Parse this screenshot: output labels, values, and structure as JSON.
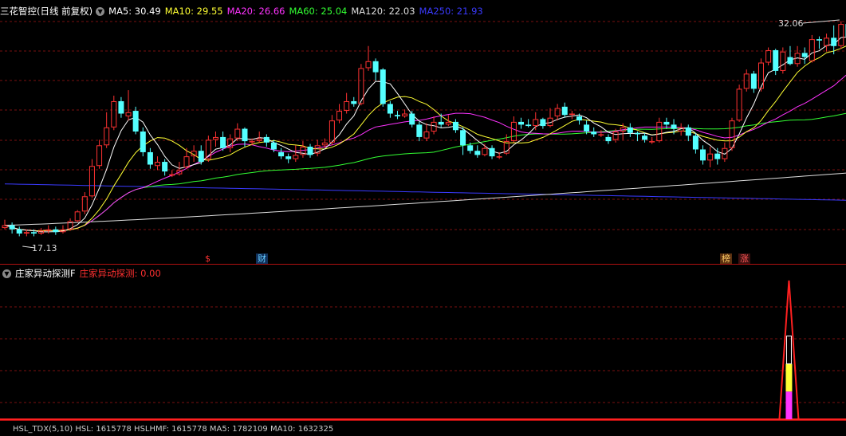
{
  "main_header": {
    "title": "三花智控(日线 前复权)",
    "ma": [
      {
        "label": "MA5: 30.49",
        "color": "#ffffff"
      },
      {
        "label": "MA10: 29.55",
        "color": "#ffff33"
      },
      {
        "label": "MA20: 26.66",
        "color": "#ff33ff"
      },
      {
        "label": "MA60: 25.04",
        "color": "#33ff33"
      },
      {
        "label": "MA120: 22.03",
        "color": "#dddddd"
      },
      {
        "label": "MA250: 21.93",
        "color": "#3a3aff"
      }
    ]
  },
  "price_labels": {
    "high": "32.06",
    "low": "17.13"
  },
  "markers": [
    {
      "text": "$",
      "color": "#ff3333"
    },
    {
      "text": "财",
      "color": "#66ccff"
    },
    {
      "text": "榜",
      "color": "#ffcc66"
    },
    {
      "text": "涨",
      "color": "#ff5555"
    }
  ],
  "indicator_header": {
    "title": "庄家异动探测F",
    "value": "庄家异动探测: 0.00",
    "value_color": "#ff3030"
  },
  "bottom_header": {
    "text": "HSL_TDX(5,10) HSL: 1615778 HSLHMF: 1615778 MA5: 1782109 MA10: 1632325"
  },
  "colors": {
    "up": "#ff3232",
    "down": "#54ffff",
    "grid": "#7a1010",
    "divider": "#b01010",
    "ma5": "#ffffff",
    "ma10": "#ffff33",
    "ma20": "#ff33ff",
    "ma60": "#33ff33",
    "ma120": "#dddddd",
    "ma250": "#3a3aff"
  },
  "chart_data": {
    "type": "candlestick",
    "ylim": [
      16.5,
      33.5
    ],
    "candles": [
      [
        18.0,
        18.2,
        18.6,
        17.9
      ],
      [
        18.2,
        17.9,
        18.4,
        17.6
      ],
      [
        17.9,
        17.6,
        18.1,
        17.4
      ],
      [
        17.6,
        17.7,
        17.9,
        17.4
      ],
      [
        17.7,
        17.6,
        17.9,
        17.4
      ],
      [
        17.6,
        17.8,
        18.0,
        17.5
      ],
      [
        17.8,
        17.9,
        18.2,
        17.6
      ],
      [
        17.9,
        17.7,
        18.1,
        17.5
      ],
      [
        17.7,
        17.9,
        18.2,
        17.6
      ],
      [
        17.9,
        18.5,
        18.7,
        17.8
      ],
      [
        18.5,
        19.2,
        19.3,
        18.4
      ],
      [
        19.2,
        20.3,
        20.6,
        19.0
      ],
      [
        20.3,
        22.5,
        23.0,
        20.2
      ],
      [
        22.5,
        24.0,
        24.4,
        22.3
      ],
      [
        24.0,
        25.3,
        26.4,
        23.8
      ],
      [
        25.3,
        27.2,
        27.6,
        25.1
      ],
      [
        27.2,
        26.3,
        27.5,
        26.0
      ],
      [
        26.1,
        26.4,
        28.0,
        25.8
      ],
      [
        26.5,
        25.0,
        26.8,
        24.8
      ],
      [
        25.0,
        23.5,
        25.3,
        23.2
      ],
      [
        23.5,
        22.6,
        23.8,
        22.3
      ],
      [
        22.5,
        22.8,
        23.2,
        22.2
      ],
      [
        22.8,
        22.1,
        23.0,
        21.8
      ],
      [
        21.8,
        21.9,
        22.2,
        21.7
      ],
      [
        21.9,
        22.2,
        22.8,
        21.8
      ],
      [
        22.4,
        23.2,
        23.8,
        22.3
      ],
      [
        23.2,
        23.6,
        24.0,
        22.8
      ],
      [
        23.6,
        22.8,
        24.0,
        22.6
      ],
      [
        23.0,
        24.4,
        24.7,
        22.8
      ],
      [
        24.4,
        24.6,
        25.0,
        23.9
      ],
      [
        24.6,
        23.8,
        25.0,
        23.6
      ],
      [
        23.8,
        24.5,
        24.8,
        23.5
      ],
      [
        24.5,
        25.2,
        25.6,
        24.3
      ],
      [
        25.2,
        24.3,
        25.3,
        23.9
      ],
      [
        24.3,
        24.3,
        24.5,
        24.0
      ],
      [
        24.3,
        24.5,
        25.0,
        24.2
      ],
      [
        24.6,
        24.2,
        24.8,
        23.9
      ],
      [
        24.2,
        23.7,
        24.4,
        23.5
      ],
      [
        23.5,
        23.2,
        23.8,
        23.0
      ],
      [
        23.2,
        23.0,
        23.4,
        22.7
      ],
      [
        23.0,
        23.3,
        24.0,
        22.8
      ],
      [
        23.3,
        23.9,
        24.3,
        23.1
      ],
      [
        23.9,
        23.3,
        24.1,
        23.1
      ],
      [
        23.4,
        24.0,
        24.4,
        23.2
      ],
      [
        24.0,
        24.2,
        24.5,
        23.8
      ],
      [
        24.2,
        25.8,
        26.2,
        24.0
      ],
      [
        25.8,
        26.5,
        27.0,
        25.6
      ],
      [
        26.5,
        27.2,
        27.8,
        26.3
      ],
      [
        27.2,
        27.0,
        27.5,
        26.8
      ],
      [
        27.0,
        29.6,
        29.9,
        26.9
      ],
      [
        29.6,
        30.1,
        31.2,
        29.4
      ],
      [
        30.1,
        29.3,
        30.3,
        28.7
      ],
      [
        29.5,
        27.0,
        29.6,
        26.8
      ],
      [
        27.0,
        26.3,
        27.2,
        26.0
      ],
      [
        26.2,
        26.1,
        26.5,
        25.9
      ],
      [
        26.1,
        26.3,
        26.6,
        26.0
      ],
      [
        26.3,
        25.5,
        26.5,
        25.3
      ],
      [
        25.5,
        24.6,
        25.7,
        24.3
      ],
      [
        24.5,
        25.0,
        25.6,
        24.3
      ],
      [
        25.0,
        25.7,
        26.1,
        24.8
      ],
      [
        25.7,
        25.5,
        26.3,
        25.3
      ],
      [
        25.5,
        25.7,
        26.2,
        25.4
      ],
      [
        25.7,
        25.1,
        25.9,
        24.9
      ],
      [
        25.1,
        24.0,
        25.3,
        23.3
      ],
      [
        24.0,
        23.6,
        24.2,
        23.4
      ],
      [
        23.6,
        23.3,
        24.0,
        23.1
      ],
      [
        23.3,
        23.8,
        24.1,
        23.2
      ],
      [
        23.8,
        23.2,
        24.0,
        23.0
      ],
      [
        23.2,
        23.2,
        23.5,
        23.0
      ],
      [
        23.4,
        24.3,
        24.8,
        23.3
      ],
      [
        24.3,
        25.7,
        26.1,
        24.2
      ],
      [
        25.7,
        25.5,
        26.0,
        25.2
      ],
      [
        25.5,
        25.4,
        25.9,
        25.3
      ],
      [
        25.4,
        25.9,
        26.4,
        25.1
      ],
      [
        25.9,
        25.4,
        26.0,
        25.2
      ],
      [
        25.4,
        26.0,
        26.7,
        25.3
      ],
      [
        26.1,
        26.7,
        27.0,
        25.8
      ],
      [
        26.8,
        26.2,
        27.1,
        26.0
      ],
      [
        26.3,
        26.3,
        26.5,
        25.9
      ],
      [
        26.1,
        25.8,
        26.3,
        25.5
      ],
      [
        25.5,
        25.0,
        25.8,
        24.8
      ],
      [
        25.0,
        24.8,
        25.3,
        24.6
      ],
      [
        24.8,
        24.8,
        25.1,
        24.6
      ],
      [
        24.6,
        24.3,
        24.8,
        24.1
      ],
      [
        24.4,
        25.0,
        25.2,
        24.2
      ],
      [
        25.0,
        25.3,
        25.6,
        24.4
      ],
      [
        25.3,
        24.9,
        25.6,
        24.6
      ],
      [
        24.9,
        24.8,
        25.0,
        24.3
      ],
      [
        24.7,
        24.4,
        24.9,
        24.2
      ],
      [
        24.3,
        24.3,
        24.6,
        24.1
      ],
      [
        24.3,
        25.7,
        26.0,
        24.2
      ],
      [
        25.7,
        25.5,
        26.0,
        25.2
      ],
      [
        25.5,
        25.2,
        25.9,
        24.8
      ],
      [
        25.0,
        25.3,
        25.6,
        24.7
      ],
      [
        25.3,
        24.7,
        25.5,
        24.3
      ],
      [
        24.7,
        23.7,
        24.9,
        23.4
      ],
      [
        23.7,
        22.9,
        24.0,
        22.6
      ],
      [
        22.9,
        23.4,
        23.9,
        22.4
      ],
      [
        23.4,
        23.0,
        23.8,
        22.6
      ],
      [
        23.0,
        23.8,
        24.2,
        22.8
      ],
      [
        23.8,
        25.8,
        26.0,
        23.6
      ],
      [
        25.8,
        28.1,
        28.4,
        25.7
      ],
      [
        28.1,
        29.2,
        29.5,
        27.9
      ],
      [
        29.2,
        28.1,
        29.4,
        27.8
      ],
      [
        28.1,
        30.0,
        30.3,
        27.9
      ],
      [
        30.0,
        30.9,
        31.1,
        29.8
      ],
      [
        30.9,
        29.4,
        31.0,
        29.1
      ],
      [
        29.4,
        30.8,
        31.1,
        29.2
      ],
      [
        30.4,
        29.9,
        31.2,
        29.8
      ],
      [
        29.9,
        30.7,
        31.2,
        29.7
      ],
      [
        30.7,
        30.4,
        31.1,
        29.9
      ],
      [
        30.1,
        31.7,
        32.0,
        30.0
      ],
      [
        31.7,
        31.6,
        31.9,
        31.0
      ],
      [
        31.2,
        31.8,
        32.1,
        30.8
      ],
      [
        31.8,
        31.2,
        32.7,
        30.6
      ],
      [
        31.2,
        32.8,
        33.0,
        31.0
      ],
      [
        32.8,
        31.9,
        33.0,
        31.6
      ]
    ],
    "indicator": {
      "value": 0.0,
      "spike_index": 108,
      "spike_value": 1.0,
      "bar_segments": [
        {
          "color": "#ff33ff",
          "from": 0.0,
          "to": 0.2
        },
        {
          "color": "#ffff33",
          "from": 0.2,
          "to": 0.4
        },
        {
          "color": "#ffffff",
          "from": 0.4,
          "to": 0.6
        }
      ]
    }
  }
}
